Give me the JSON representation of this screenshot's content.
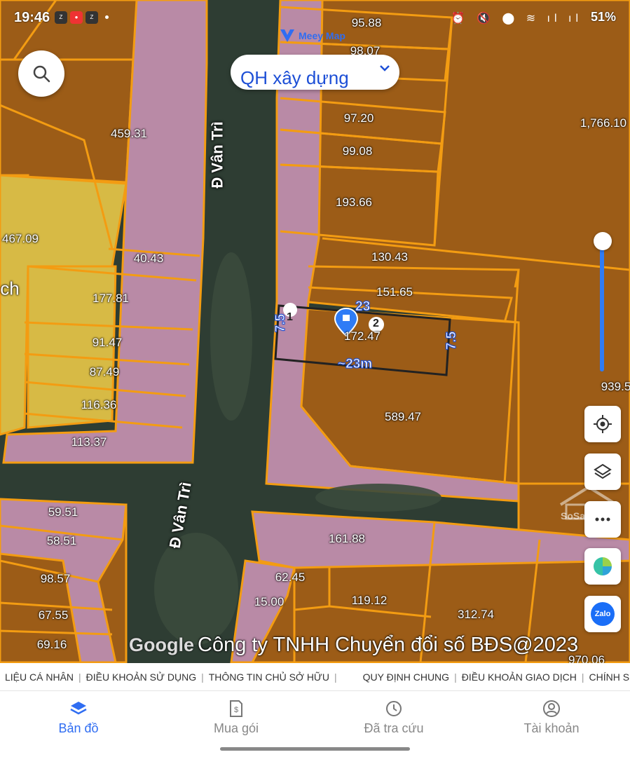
{
  "status_bar": {
    "time": "19:46",
    "battery": "51%",
    "icons": [
      "zalo-icon",
      "recorder-icon",
      "zalo-icon",
      "dot-icon",
      "alarm-icon",
      "mute-icon",
      "location-icon",
      "wifi-icon",
      "volte-icon",
      "signal-icon",
      "signal-icon",
      "battery-icon"
    ]
  },
  "brand": {
    "name": "Meey Map",
    "color": "#2f6df2"
  },
  "layer_select": {
    "label": "QH xây dựng"
  },
  "map": {
    "colors": {
      "planning": "#9c5c17",
      "road": "#b98aa6",
      "residential": "#d7ba45",
      "boundary": "#f39c12",
      "selection": "#222222"
    },
    "parcel_labels": [
      "95.88",
      "98.07",
      "97.20",
      "99.08",
      "193.66",
      "1,766.10",
      "459.31",
      "467.09",
      "40.43",
      "130.43",
      "151.65",
      "177.81",
      "172.47",
      "91.47",
      "87.49",
      "589.47",
      "116.36",
      "113.37",
      "939.5",
      "59.51",
      "58.51",
      "161.88",
      "98.57",
      "62.45",
      "15.00",
      "119.12",
      "67.55",
      "312.74",
      "69.16",
      "970.06"
    ],
    "street_labels": [
      "Đ Vân Trì",
      "Đ Vân Trì"
    ],
    "partial_label": "ch",
    "measure": {
      "side_left": "7.5",
      "side_top": "23",
      "side_right": "7.5",
      "length": "~23m",
      "vertex_1": "1",
      "vertex_2": "2"
    },
    "watermark": "SoSanhNha"
  },
  "copyright": "Công ty TNHH Chuyển đổi số BĐS@2023",
  "google_logo": "Google",
  "footer_links": [
    "LIỆU CÁ NHÂN",
    "ĐIỀU KHOẢN SỬ DỤNG",
    "THÔNG TIN CHỦ SỞ HỮU",
    "QUY ĐỊNH CHUNG",
    "ĐIỀU KHOẢN GIAO DỊCH",
    "CHÍNH S"
  ],
  "right_controls": [
    "locate-icon",
    "layers-icon",
    "more-icon",
    "chart-icon",
    "zalo-icon"
  ],
  "zalo_label": "Zalo",
  "bottom_nav": [
    {
      "label": "Bản đồ",
      "icon": "layers-icon",
      "active": true
    },
    {
      "label": "Mua gói",
      "icon": "invoice-icon",
      "active": false
    },
    {
      "label": "Đã tra cứu",
      "icon": "clock-icon",
      "active": false
    },
    {
      "label": "Tài khoản",
      "icon": "user-icon",
      "active": false
    }
  ]
}
